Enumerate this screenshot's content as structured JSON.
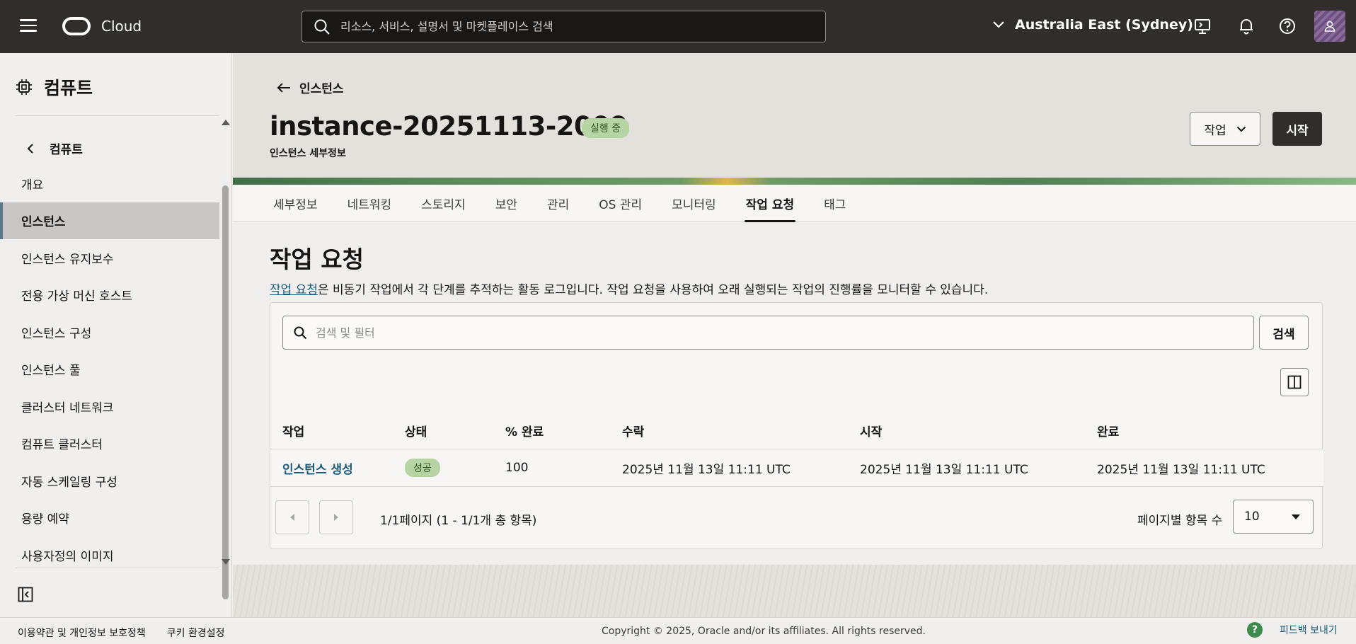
{
  "header": {
    "logo_text": "Cloud",
    "search_placeholder": "리소스, 서비스, 설명서 및 마켓플레이스 검색",
    "region": "Australia East (Sydney)"
  },
  "sidebar": {
    "title": "컴퓨트",
    "back_label": "컴퓨트",
    "items": [
      {
        "label": "개요"
      },
      {
        "label": "인스턴스"
      },
      {
        "label": "인스턴스 유지보수"
      },
      {
        "label": "전용 가상 머신 호스트"
      },
      {
        "label": "인스턴스 구성"
      },
      {
        "label": "인스턴스 풀"
      },
      {
        "label": "클러스터 네트워크"
      },
      {
        "label": "컴퓨트 클러스터"
      },
      {
        "label": "자동 스케일링 구성"
      },
      {
        "label": "용량 예약"
      },
      {
        "label": "사용자정의 이미지"
      }
    ]
  },
  "page": {
    "back_label": "인스턴스",
    "title": "instance-20251113-2009",
    "status": "실행 중",
    "subtitle": "인스턴스 세부정보",
    "action_button": "작업",
    "start_button": "시작"
  },
  "tabs": [
    {
      "label": "세부정보"
    },
    {
      "label": "네트워킹"
    },
    {
      "label": "스토리지"
    },
    {
      "label": "보안"
    },
    {
      "label": "관리"
    },
    {
      "label": "OS 관리"
    },
    {
      "label": "모니터링"
    },
    {
      "label": "작업 요청"
    },
    {
      "label": "태그"
    }
  ],
  "section": {
    "title": "작업 요청",
    "desc_link": "작업 요청",
    "desc_rest": "은 비동기 작업에서 각 단계를 추적하는 활동 로그입니다. 작업 요청을 사용하여 오래 실행되는 작업의 진행률을 모니터할 수 있습니다.",
    "filter_placeholder": "검색 및 필터",
    "search_button": "검색"
  },
  "table": {
    "headers": [
      "작업",
      "상태",
      "% 완료",
      "수락",
      "시작",
      "완료"
    ],
    "rows": [
      {
        "operation": "인스턴스 생성",
        "status": "성공",
        "percent": "100",
        "accepted": "2025년 11월 13일 11:11 UTC",
        "started": "2025년 11월 13일 11:11 UTC",
        "finished": "2025년 11월 13일 11:11 UTC"
      }
    ]
  },
  "pager": {
    "text": "1/1페이지 (1 - 1/1개 총 항목)",
    "page_size_label": "페이지별 항목 수",
    "page_size": "10"
  },
  "footer": {
    "terms": "이용약관 및 개인정보 보호정책",
    "cookies": "쿠키 환경설정",
    "copyright": "Copyright © 2025, Oracle and/or its affiliates. All rights reserved.",
    "help": "?",
    "feedback": "피드백 보내기"
  }
}
